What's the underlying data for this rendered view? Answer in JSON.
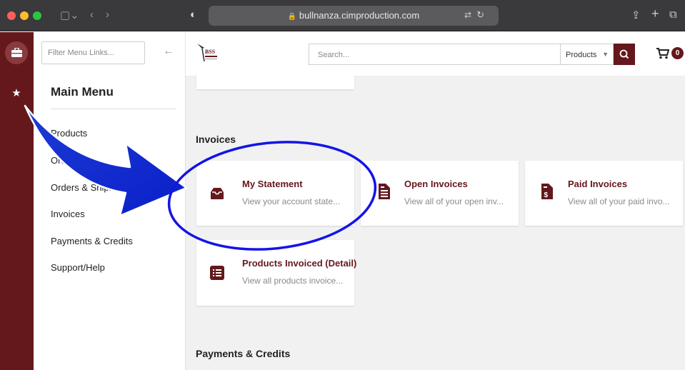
{
  "browser": {
    "url": "bullnanza.cimproduction.com",
    "traffic_colors": [
      "#ff5f57",
      "#febc2e",
      "#28c840"
    ]
  },
  "rail": {
    "items": [
      {
        "name": "briefcase-icon",
        "glyph": "💼"
      },
      {
        "name": "star-icon",
        "glyph": "★"
      }
    ]
  },
  "sidebar": {
    "filter_placeholder": "Filter Menu Links...",
    "title": "Main Menu",
    "items": [
      {
        "label": "Products"
      },
      {
        "label": "Orders"
      },
      {
        "label": "Orders & Shipments"
      },
      {
        "label": "Invoices"
      },
      {
        "label": "Payments & Credits"
      },
      {
        "label": "Support/Help"
      }
    ]
  },
  "header": {
    "search_placeholder": "Search...",
    "search_category": "Products",
    "cart_count": "0"
  },
  "content": {
    "invoices_title": "Invoices",
    "payments_title": "Payments & Credits",
    "cards": [
      {
        "title": "My Statement",
        "desc": "View your account state...",
        "icon": "inbox-icon"
      },
      {
        "title": "Open Invoices",
        "desc": "View all of your open inv...",
        "icon": "invoice-icon"
      },
      {
        "title": "Paid Invoices",
        "desc": "View all of your paid invo...",
        "icon": "paid-invoice-icon"
      },
      {
        "title": "Products Invoiced (Detail)",
        "desc": "View all products invoice...",
        "icon": "list-icon"
      }
    ]
  },
  "colors": {
    "brand": "#64181c",
    "annotation_blue": "#1414e6"
  }
}
